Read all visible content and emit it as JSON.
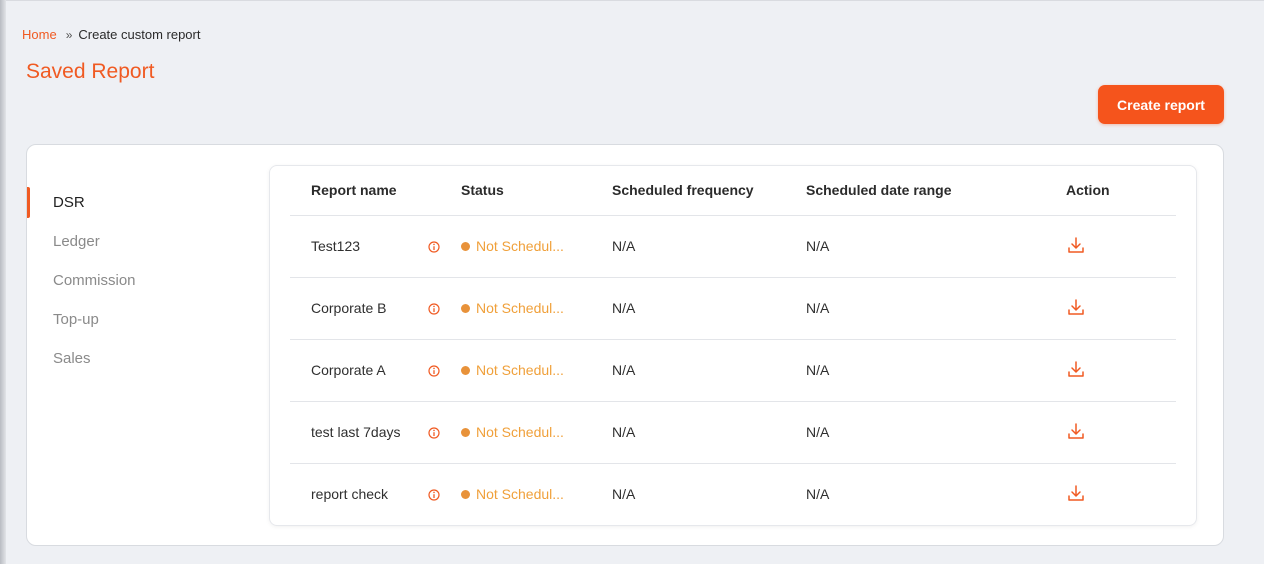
{
  "breadcrumb": {
    "home": "Home",
    "separator": "»",
    "current": "Create custom report"
  },
  "page": {
    "title": "Saved Report"
  },
  "actions": {
    "create_label": "Create report"
  },
  "sidebar": {
    "items": [
      {
        "label": "DSR",
        "active": true
      },
      {
        "label": "Ledger",
        "active": false
      },
      {
        "label": "Commission",
        "active": false
      },
      {
        "label": "Top-up",
        "active": false
      },
      {
        "label": "Sales",
        "active": false
      }
    ]
  },
  "table": {
    "headers": [
      "Report name",
      "Status",
      "Scheduled frequency",
      "Scheduled date range",
      "Action"
    ],
    "rows": [
      {
        "name": "Test123",
        "status": "Not Schedul...",
        "frequency": "N/A",
        "date_range": "N/A"
      },
      {
        "name": "Corporate B",
        "status": "Not Schedul...",
        "frequency": "N/A",
        "date_range": "N/A"
      },
      {
        "name": "Corporate A",
        "status": "Not Schedul...",
        "frequency": "N/A",
        "date_range": "N/A"
      },
      {
        "name": "test last 7days",
        "status": "Not Schedul...",
        "frequency": "N/A",
        "date_range": "N/A"
      },
      {
        "name": "report check",
        "status": "Not Schedul...",
        "frequency": "N/A",
        "date_range": "N/A"
      }
    ]
  },
  "colors": {
    "accent": "#f05a22",
    "button": "#f5541c",
    "status_pending": "#f0a03a",
    "background": "#eef0f4"
  },
  "icons": {
    "info": "info-icon",
    "download": "download-icon"
  }
}
